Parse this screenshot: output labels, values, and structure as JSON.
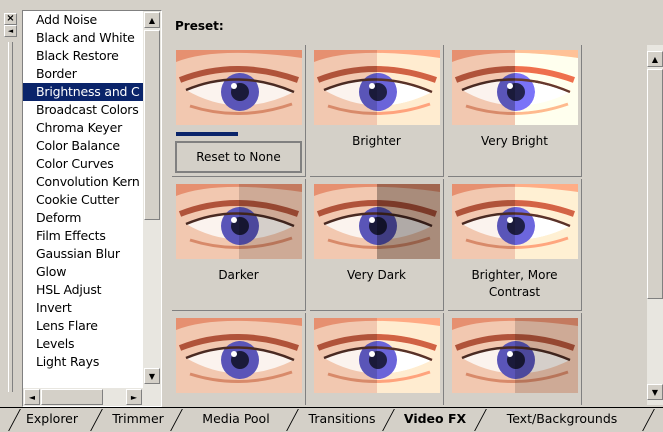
{
  "header": {
    "preset_label": "Preset:"
  },
  "controls": {
    "close_glyph": "×",
    "collapse_glyph": "◄"
  },
  "effects": [
    "Add Noise",
    "Black and White",
    "Black Restore",
    "Border",
    "Brightness and C",
    "Broadcast Colors",
    "Chroma Keyer",
    "Color Balance",
    "Color Curves",
    "Convolution Kern",
    "Cookie Cutter",
    "Deform",
    "Film Effects",
    "Gaussian Blur",
    "Glow",
    "HSL Adjust",
    "Invert",
    "Lens Flare",
    "Levels",
    "Light Rays"
  ],
  "selected_effect": "Brightness and C",
  "presets": [
    {
      "label": "Reset to None",
      "tone": "normal"
    },
    {
      "label": "Brighter",
      "tone": "brighter"
    },
    {
      "label": "Very Bright",
      "tone": "verybright"
    },
    {
      "label": "Darker",
      "tone": "darker"
    },
    {
      "label": "Very Dark",
      "tone": "verydark"
    },
    {
      "label": "Brighter, More Contrast",
      "tone": "contrast"
    },
    {
      "label": "",
      "tone": "normal"
    },
    {
      "label": "",
      "tone": "brighter"
    },
    {
      "label": "",
      "tone": "darker"
    }
  ],
  "tabs": [
    {
      "label": "Explorer",
      "active": false
    },
    {
      "label": "Trimmer",
      "active": false
    },
    {
      "label": "Media Pool",
      "active": false
    },
    {
      "label": "Transitions",
      "active": false
    },
    {
      "label": "Video FX",
      "active": true
    },
    {
      "label": "Text/Backgrounds",
      "active": false
    }
  ],
  "colors": {
    "selection": "#0a246a",
    "panel": "#d4d0c8",
    "iris": "#5a55b8"
  }
}
